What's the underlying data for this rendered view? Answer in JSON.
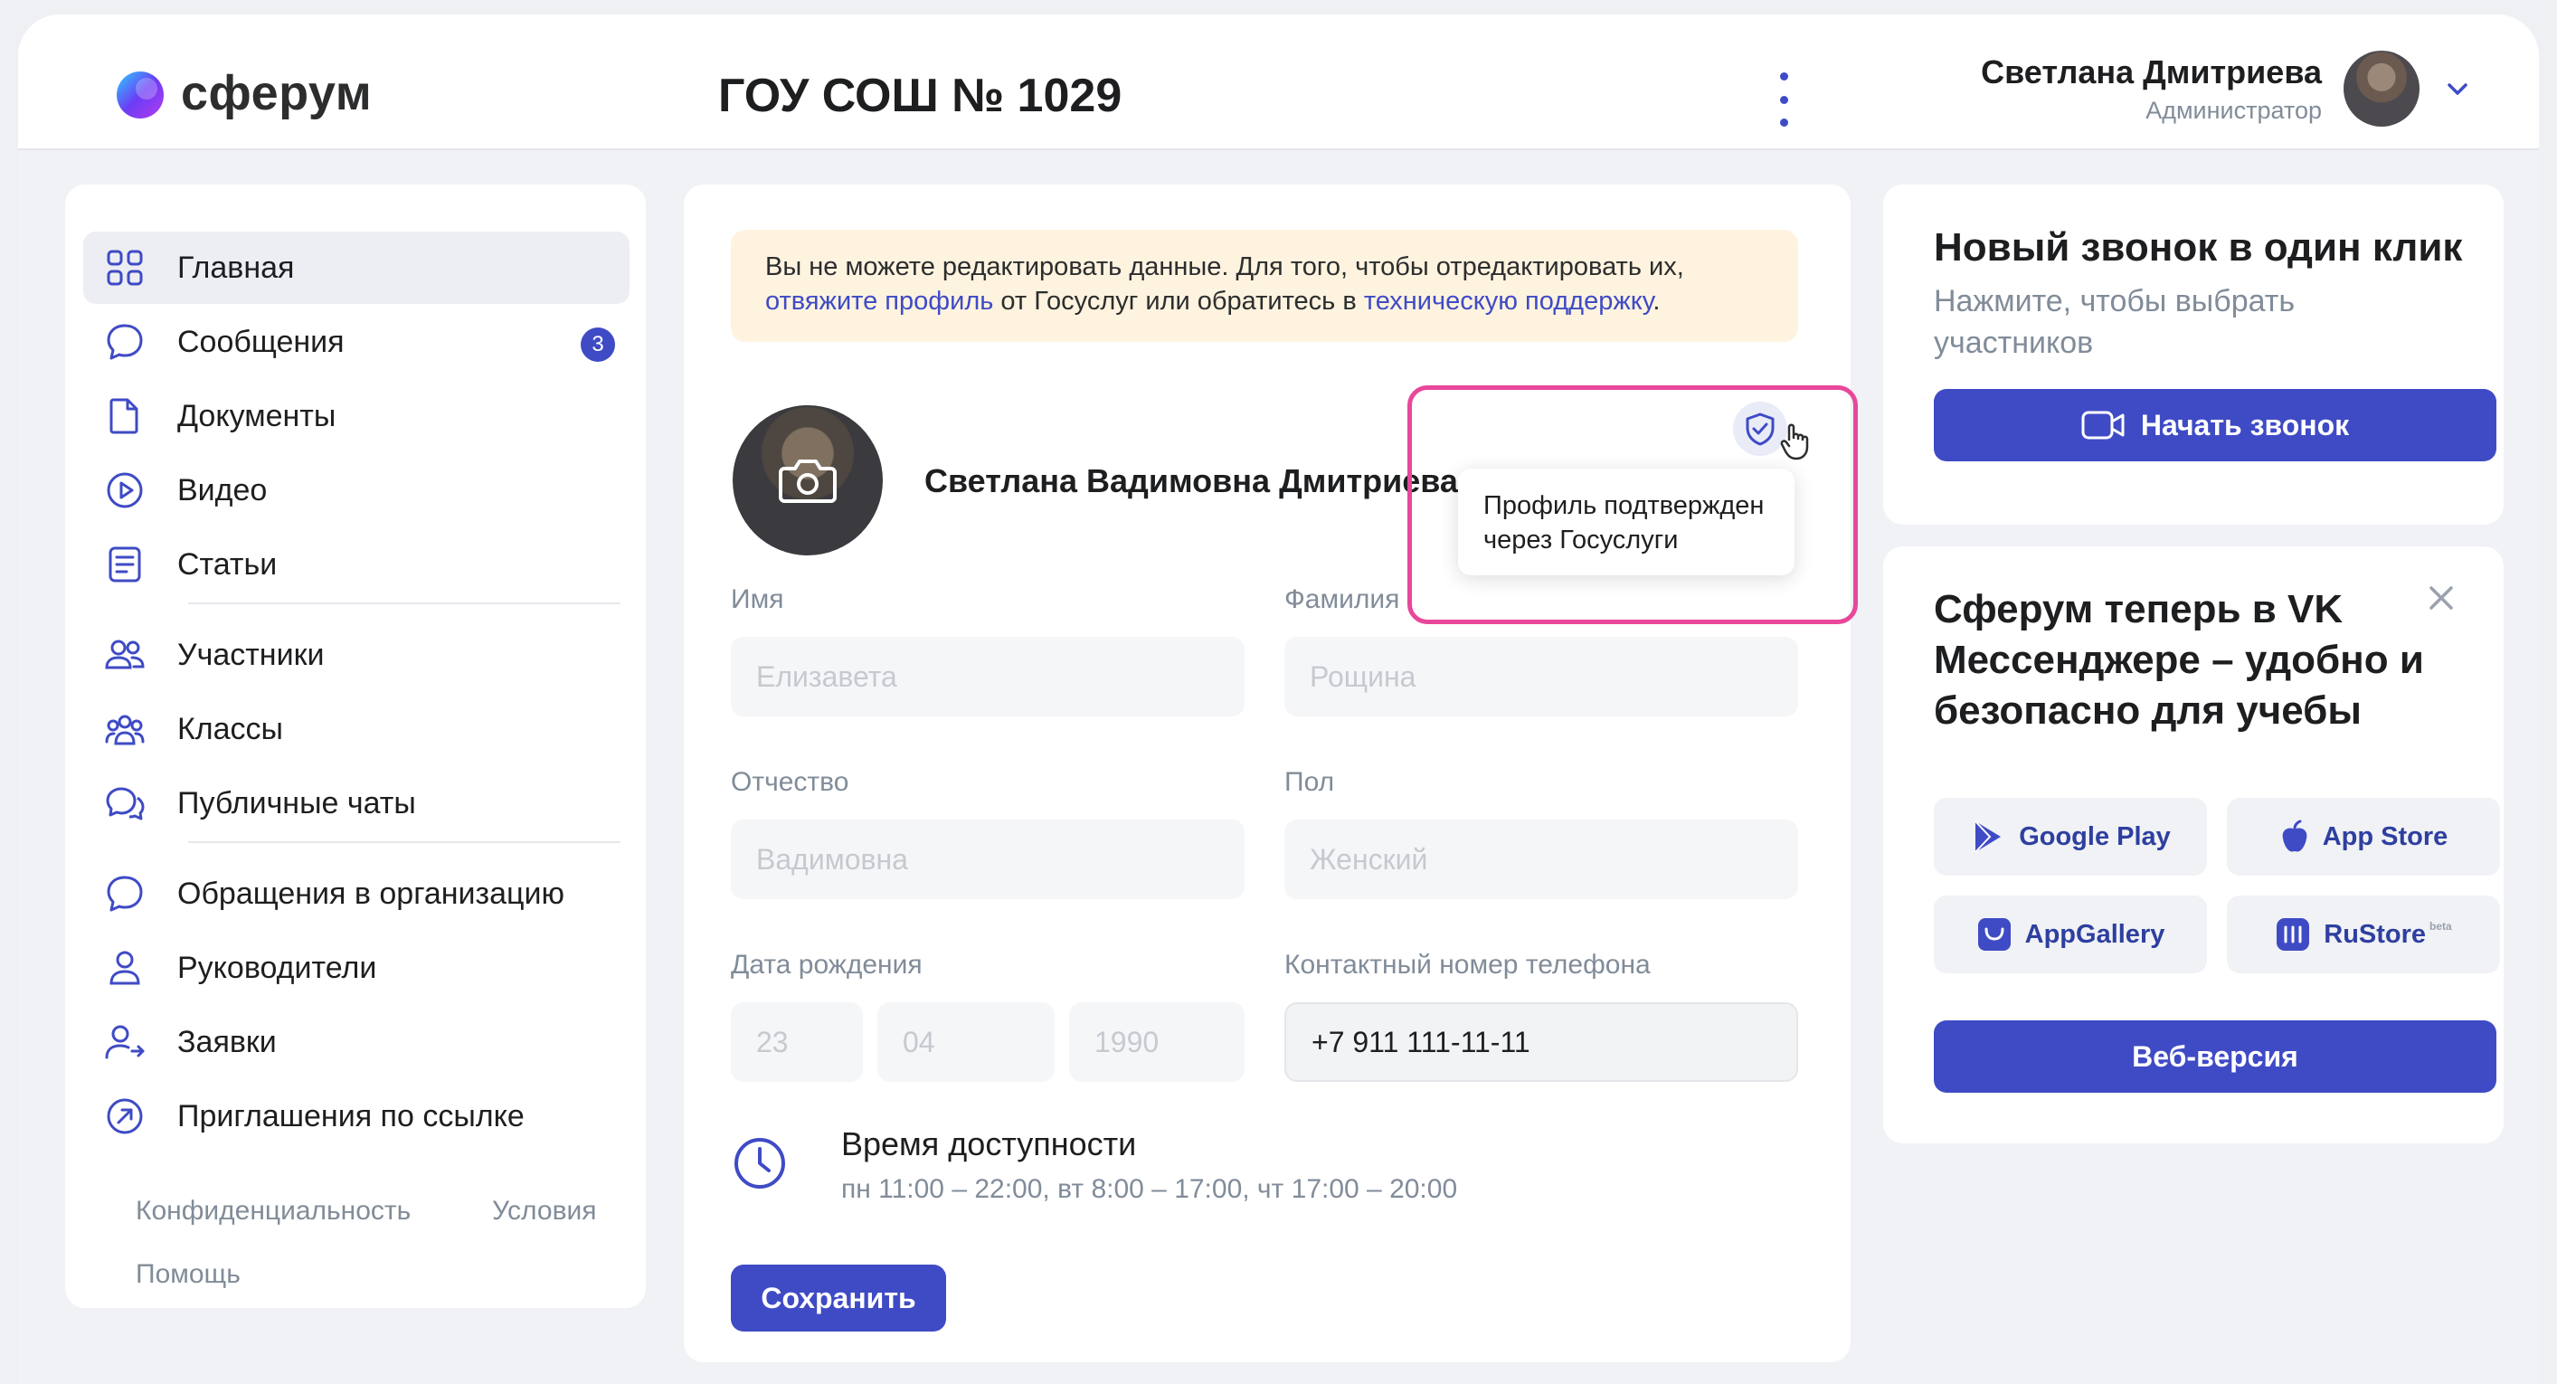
{
  "header": {
    "logo_text": "сферум",
    "org_title": "ГОУ СОШ № 1029",
    "user_name": "Светлана Дмитриева",
    "user_role": "Администратор"
  },
  "sidebar": {
    "items": [
      {
        "label": "Главная",
        "icon": "grid-icon"
      },
      {
        "label": "Сообщения",
        "icon": "chat-icon",
        "badge": "3"
      },
      {
        "label": "Документы",
        "icon": "document-icon"
      },
      {
        "label": "Видео",
        "icon": "play-icon"
      },
      {
        "label": "Статьи",
        "icon": "article-icon"
      },
      {
        "label": "Участники",
        "icon": "people-icon"
      },
      {
        "label": "Классы",
        "icon": "group-icon"
      },
      {
        "label": "Публичные чаты",
        "icon": "public-chat-icon"
      },
      {
        "label": "Обращения в организацию",
        "icon": "chat-icon"
      },
      {
        "label": "Руководители",
        "icon": "person-icon"
      },
      {
        "label": "Заявки",
        "icon": "person-arrow-icon"
      },
      {
        "label": "Приглашения по ссылке",
        "icon": "link-arrow-icon"
      }
    ],
    "footer": {
      "privacy": "Конфиденциальность",
      "terms": "Условия",
      "help": "Помощь"
    }
  },
  "main": {
    "warning": {
      "text1": "Вы не можете редактировать данные. Для того, чтобы отредактировать их, ",
      "link1": "отвяжите профиль",
      "text2": " от Госуслуг или обратитесь в ",
      "link2": "техническую поддержку",
      "text3": "."
    },
    "full_name": "Светлана Вадимовна Дмитриева",
    "tooltip": "Профиль подтвержден через Госуслуги",
    "fields": {
      "first_name_label": "Имя",
      "first_name_value": "Елизавета",
      "last_name_label": "Фамилия",
      "last_name_value": "Рощина",
      "patronymic_label": "Отчество",
      "patronymic_value": "Вадимовна",
      "gender_label": "Пол",
      "gender_value": "Женский",
      "birth_label": "Дата рождения",
      "birth_day": "23",
      "birth_month": "04",
      "birth_year": "1990",
      "phone_label": "Контактный номер телефона",
      "phone_value": "+7 911 111-11-11"
    },
    "availability": {
      "title": "Время доступности",
      "schedule": "пн 11:00 – 22:00, вт 8:00 – 17:00, чт 17:00 – 20:00"
    },
    "save_label": "Сохранить"
  },
  "call_card": {
    "title": "Новый звонок в один клик",
    "subtitle": "Нажмите, чтобы выбрать участников",
    "button": "Начать звонок"
  },
  "messenger_card": {
    "title": "Сферум теперь в VK Мессенджере – удобно и безопасно для учебы",
    "stores": {
      "google": "Google Play",
      "apple": "App Store",
      "appgallery": "AppGallery",
      "rustore": "RuStore",
      "rustore_tag": "beta"
    },
    "web_button": "Веб-версия"
  },
  "colors": {
    "accent": "#3f4bc5",
    "highlight": "#e8479a",
    "warning_bg": "#fdf3df"
  }
}
